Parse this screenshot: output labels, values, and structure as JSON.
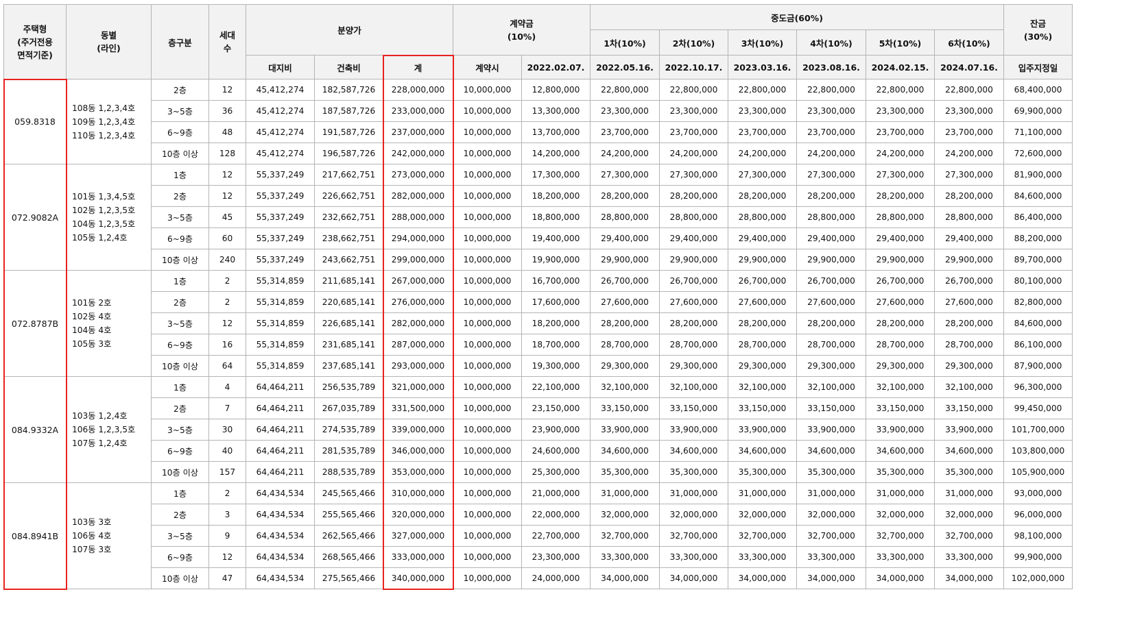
{
  "header": {
    "type": [
      "주택형",
      "(주거전용",
      "면적기준)"
    ],
    "dong": [
      "동별",
      "(라인)"
    ],
    "floor": "층구분",
    "units": [
      "세대",
      "수"
    ],
    "price": "분양가",
    "price_land": "대지비",
    "price_building": "건축비",
    "price_total": "계",
    "deposit": [
      "계약금",
      "(10%)"
    ],
    "deposit_at_contract": "계약시",
    "deposit_date": "2022.02.07.",
    "middle": "중도금(60%)",
    "middle_rounds": [
      {
        "round": "1차(10%)",
        "date": "2022.05.16."
      },
      {
        "round": "2차(10%)",
        "date": "2022.10.17."
      },
      {
        "round": "3차(10%)",
        "date": "2023.03.16."
      },
      {
        "round": "4차(10%)",
        "date": "2023.08.16."
      },
      {
        "round": "5차(10%)",
        "date": "2024.02.15."
      },
      {
        "round": "6차(10%)",
        "date": "2024.07.16."
      }
    ],
    "balance": [
      "잔금",
      "(30%)"
    ],
    "balance_date": "입주지정일"
  },
  "groups": [
    {
      "type": "059.8318",
      "dongs": [
        "108동 1,2,3,4호",
        "109동 1,2,3,4호",
        "110동 1,2,3,4호"
      ],
      "rows": [
        {
          "floor": "2층",
          "units": "12",
          "land": "45,412,274",
          "building": "182,587,726",
          "total": "228,000,000",
          "contract": "10,000,000",
          "deposit2": "12,800,000",
          "middle": "22,800,000",
          "balance": "68,400,000"
        },
        {
          "floor": "3~5층",
          "units": "36",
          "land": "45,412,274",
          "building": "187,587,726",
          "total": "233,000,000",
          "contract": "10,000,000",
          "deposit2": "13,300,000",
          "middle": "23,300,000",
          "balance": "69,900,000"
        },
        {
          "floor": "6~9층",
          "units": "48",
          "land": "45,412,274",
          "building": "191,587,726",
          "total": "237,000,000",
          "contract": "10,000,000",
          "deposit2": "13,700,000",
          "middle": "23,700,000",
          "balance": "71,100,000"
        },
        {
          "floor": "10층 이상",
          "units": "128",
          "land": "45,412,274",
          "building": "196,587,726",
          "total": "242,000,000",
          "contract": "10,000,000",
          "deposit2": "14,200,000",
          "middle": "24,200,000",
          "balance": "72,600,000"
        }
      ]
    },
    {
      "type": "072.9082A",
      "dongs": [
        "101동 1,3,4,5호",
        "102동 1,2,3,5호",
        "104동 1,2,3,5호",
        "105동 1,2,4호"
      ],
      "rows": [
        {
          "floor": "1층",
          "units": "12",
          "land": "55,337,249",
          "building": "217,662,751",
          "total": "273,000,000",
          "contract": "10,000,000",
          "deposit2": "17,300,000",
          "middle": "27,300,000",
          "balance": "81,900,000"
        },
        {
          "floor": "2층",
          "units": "12",
          "land": "55,337,249",
          "building": "226,662,751",
          "total": "282,000,000",
          "contract": "10,000,000",
          "deposit2": "18,200,000",
          "middle": "28,200,000",
          "balance": "84,600,000"
        },
        {
          "floor": "3~5층",
          "units": "45",
          "land": "55,337,249",
          "building": "232,662,751",
          "total": "288,000,000",
          "contract": "10,000,000",
          "deposit2": "18,800,000",
          "middle": "28,800,000",
          "balance": "86,400,000"
        },
        {
          "floor": "6~9층",
          "units": "60",
          "land": "55,337,249",
          "building": "238,662,751",
          "total": "294,000,000",
          "contract": "10,000,000",
          "deposit2": "19,400,000",
          "middle": "29,400,000",
          "balance": "88,200,000"
        },
        {
          "floor": "10층 이상",
          "units": "240",
          "land": "55,337,249",
          "building": "243,662,751",
          "total": "299,000,000",
          "contract": "10,000,000",
          "deposit2": "19,900,000",
          "middle": "29,900,000",
          "balance": "89,700,000"
        }
      ]
    },
    {
      "type": "072.8787B",
      "dongs": [
        "101동 2호",
        "102동 4호",
        "104동 4호",
        "105동 3호"
      ],
      "rows": [
        {
          "floor": "1층",
          "units": "2",
          "land": "55,314,859",
          "building": "211,685,141",
          "total": "267,000,000",
          "contract": "10,000,000",
          "deposit2": "16,700,000",
          "middle": "26,700,000",
          "balance": "80,100,000"
        },
        {
          "floor": "2층",
          "units": "2",
          "land": "55,314,859",
          "building": "220,685,141",
          "total": "276,000,000",
          "contract": "10,000,000",
          "deposit2": "17,600,000",
          "middle": "27,600,000",
          "balance": "82,800,000"
        },
        {
          "floor": "3~5층",
          "units": "12",
          "land": "55,314,859",
          "building": "226,685,141",
          "total": "282,000,000",
          "contract": "10,000,000",
          "deposit2": "18,200,000",
          "middle": "28,200,000",
          "balance": "84,600,000"
        },
        {
          "floor": "6~9층",
          "units": "16",
          "land": "55,314,859",
          "building": "231,685,141",
          "total": "287,000,000",
          "contract": "10,000,000",
          "deposit2": "18,700,000",
          "middle": "28,700,000",
          "balance": "86,100,000"
        },
        {
          "floor": "10층 이상",
          "units": "64",
          "land": "55,314,859",
          "building": "237,685,141",
          "total": "293,000,000",
          "contract": "10,000,000",
          "deposit2": "19,300,000",
          "middle": "29,300,000",
          "balance": "87,900,000"
        }
      ]
    },
    {
      "type": "084.9332A",
      "dongs": [
        "103동 1,2,4호",
        "106동 1,2,3,5호",
        "107동 1,2,4호"
      ],
      "rows": [
        {
          "floor": "1층",
          "units": "4",
          "land": "64,464,211",
          "building": "256,535,789",
          "total": "321,000,000",
          "contract": "10,000,000",
          "deposit2": "22,100,000",
          "middle": "32,100,000",
          "balance": "96,300,000"
        },
        {
          "floor": "2층",
          "units": "7",
          "land": "64,464,211",
          "building": "267,035,789",
          "total": "331,500,000",
          "contract": "10,000,000",
          "deposit2": "23,150,000",
          "middle": "33,150,000",
          "balance": "99,450,000"
        },
        {
          "floor": "3~5층",
          "units": "30",
          "land": "64,464,211",
          "building": "274,535,789",
          "total": "339,000,000",
          "contract": "10,000,000",
          "deposit2": "23,900,000",
          "middle": "33,900,000",
          "balance": "101,700,000"
        },
        {
          "floor": "6~9층",
          "units": "40",
          "land": "64,464,211",
          "building": "281,535,789",
          "total": "346,000,000",
          "contract": "10,000,000",
          "deposit2": "24,600,000",
          "middle": "34,600,000",
          "balance": "103,800,000"
        },
        {
          "floor": "10층 이상",
          "units": "157",
          "land": "64,464,211",
          "building": "288,535,789",
          "total": "353,000,000",
          "contract": "10,000,000",
          "deposit2": "25,300,000",
          "middle": "35,300,000",
          "balance": "105,900,000"
        }
      ]
    },
    {
      "type": "084.8941B",
      "dongs": [
        "103동 3호",
        "106동 4호",
        "107동 3호"
      ],
      "rows": [
        {
          "floor": "1층",
          "units": "2",
          "land": "64,434,534",
          "building": "245,565,466",
          "total": "310,000,000",
          "contract": "10,000,000",
          "deposit2": "21,000,000",
          "middle": "31,000,000",
          "balance": "93,000,000"
        },
        {
          "floor": "2층",
          "units": "3",
          "land": "64,434,534",
          "building": "255,565,466",
          "total": "320,000,000",
          "contract": "10,000,000",
          "deposit2": "22,000,000",
          "middle": "32,000,000",
          "balance": "96,000,000"
        },
        {
          "floor": "3~5층",
          "units": "9",
          "land": "64,434,534",
          "building": "262,565,466",
          "total": "327,000,000",
          "contract": "10,000,000",
          "deposit2": "22,700,000",
          "middle": "32,700,000",
          "balance": "98,100,000"
        },
        {
          "floor": "6~9층",
          "units": "12",
          "land": "64,434,534",
          "building": "268,565,466",
          "total": "333,000,000",
          "contract": "10,000,000",
          "deposit2": "23,300,000",
          "middle": "33,300,000",
          "balance": "99,900,000"
        },
        {
          "floor": "10층 이상",
          "units": "47",
          "land": "64,434,534",
          "building": "275,565,466",
          "total": "340,000,000",
          "contract": "10,000,000",
          "deposit2": "24,000,000",
          "middle": "34,000,000",
          "balance": "102,000,000"
        }
      ]
    }
  ],
  "colors": {
    "highlight_border": "#e8211d",
    "header_bg": "#f2f2f2",
    "grid": "#b4b4b4"
  }
}
